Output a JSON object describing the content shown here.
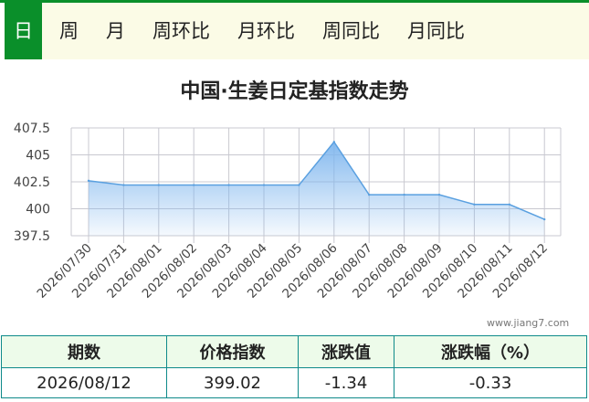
{
  "tabs": [
    {
      "label": "日",
      "active": true
    },
    {
      "label": "周",
      "active": false
    },
    {
      "label": "月",
      "active": false
    },
    {
      "label": "周环比",
      "active": false
    },
    {
      "label": "月环比",
      "active": false
    },
    {
      "label": "周同比",
      "active": false
    },
    {
      "label": "月同比",
      "active": false
    }
  ],
  "colors": {
    "accent": "#0a8f2a",
    "tab_bar_bg": "#fbfbe6",
    "line": "#5aa0e0",
    "fill_top": "#7fb6ee",
    "grid": "#c8c8d0",
    "table_border": "#0e8a8a",
    "table_header_bg": "#edfbea"
  },
  "chart_data": {
    "type": "area",
    "title": "中国·生姜日定基指数走势",
    "x": [
      "2026/07/30",
      "2026/07/31",
      "2026/08/01",
      "2026/08/02",
      "2026/08/03",
      "2026/08/04",
      "2026/08/05",
      "2026/08/06",
      "2026/08/07",
      "2026/08/08",
      "2026/08/09",
      "2026/08/10",
      "2026/08/11",
      "2026/08/12"
    ],
    "values": [
      402.6,
      402.2,
      402.2,
      402.2,
      402.2,
      402.2,
      402.2,
      406.2,
      401.3,
      401.3,
      401.3,
      400.4,
      400.4,
      399.02
    ],
    "ylim": [
      397.5,
      407.5
    ],
    "yticks": [
      "407.5",
      "405",
      "402.5",
      "400",
      "397.5"
    ],
    "grid": true,
    "legend": "none"
  },
  "watermark": "www.jiang7.com",
  "summary": {
    "headers": [
      "期数",
      "价格指数",
      "涨跌值",
      "涨跌幅（%）"
    ],
    "row": [
      "2026/08/12",
      "399.02",
      "-1.34",
      "-0.33"
    ]
  }
}
